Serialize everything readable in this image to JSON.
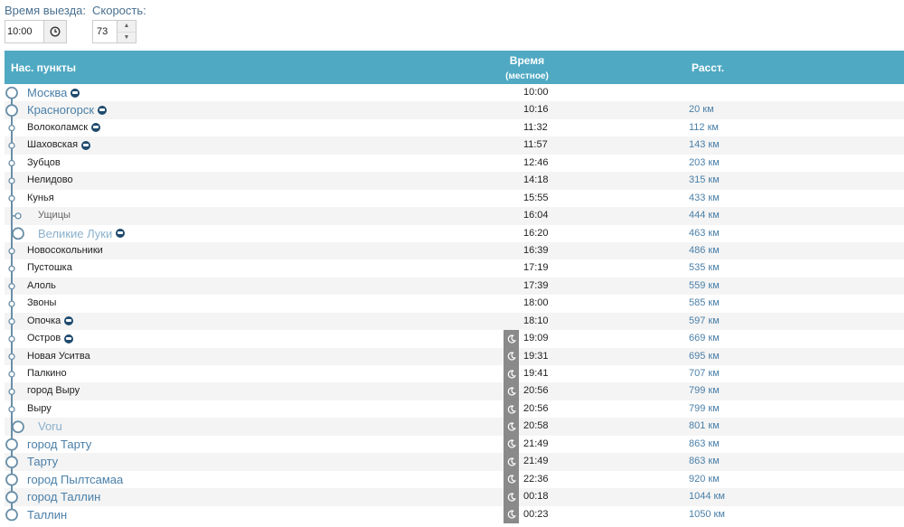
{
  "controls": {
    "departure_label": "Время выезда:",
    "departure_value": "10:00",
    "speed_label": "Скорость:",
    "speed_value": "73"
  },
  "table": {
    "col_name": "Нас. пункты",
    "col_time": "Время",
    "col_time_sub": "(местное)",
    "col_dist": "Расст."
  },
  "rows": [
    {
      "name": "Москва",
      "time": "10:00",
      "dist": "",
      "big": true,
      "bus": true,
      "branch": false,
      "night": false
    },
    {
      "name": "Красногорск",
      "time": "10:16",
      "dist": "20 км",
      "big": true,
      "bus": true,
      "branch": false,
      "night": false
    },
    {
      "name": "Волоколамск",
      "time": "11:32",
      "dist": "112 км",
      "big": false,
      "bus": true,
      "branch": false,
      "night": false
    },
    {
      "name": "Шаховская",
      "time": "11:57",
      "dist": "143 км",
      "big": false,
      "bus": true,
      "branch": false,
      "night": false
    },
    {
      "name": "Зубцов",
      "time": "12:46",
      "dist": "203 км",
      "big": false,
      "bus": false,
      "branch": false,
      "night": false
    },
    {
      "name": "Нелидово",
      "time": "14:18",
      "dist": "315 км",
      "big": false,
      "bus": false,
      "branch": false,
      "night": false
    },
    {
      "name": "Кунья",
      "time": "15:55",
      "dist": "433 км",
      "big": false,
      "bus": false,
      "branch": false,
      "night": false
    },
    {
      "name": "Ущицы",
      "time": "16:04",
      "dist": "444 км",
      "big": false,
      "bus": false,
      "branch": true,
      "night": false
    },
    {
      "name": "Великие Луки",
      "time": "16:20",
      "dist": "463 км",
      "big": true,
      "bus": true,
      "branch": true,
      "night": false
    },
    {
      "name": "Новосокольники",
      "time": "16:39",
      "dist": "486 км",
      "big": false,
      "bus": false,
      "branch": false,
      "night": false
    },
    {
      "name": "Пустошка",
      "time": "17:19",
      "dist": "535 км",
      "big": false,
      "bus": false,
      "branch": false,
      "night": false
    },
    {
      "name": "Алоль",
      "time": "17:39",
      "dist": "559 км",
      "big": false,
      "bus": false,
      "branch": false,
      "night": false
    },
    {
      "name": "Звоны",
      "time": "18:00",
      "dist": "585 км",
      "big": false,
      "bus": false,
      "branch": false,
      "night": false
    },
    {
      "name": "Опочка",
      "time": "18:10",
      "dist": "597 км",
      "big": false,
      "bus": true,
      "branch": false,
      "night": false
    },
    {
      "name": "Остров",
      "time": "19:09",
      "dist": "669 км",
      "big": false,
      "bus": true,
      "branch": false,
      "night": true
    },
    {
      "name": "Новая Уситва",
      "time": "19:31",
      "dist": "695 км",
      "big": false,
      "bus": false,
      "branch": false,
      "night": true
    },
    {
      "name": "Палкино",
      "time": "19:41",
      "dist": "707 км",
      "big": false,
      "bus": false,
      "branch": false,
      "night": true
    },
    {
      "name": "город Выру",
      "time": "20:56",
      "dist": "799 км",
      "big": false,
      "bus": false,
      "branch": false,
      "night": true
    },
    {
      "name": "Выру",
      "time": "20:56",
      "dist": "799 км",
      "big": false,
      "bus": false,
      "branch": false,
      "night": true
    },
    {
      "name": "Voru",
      "time": "20:58",
      "dist": "801 км",
      "big": true,
      "bus": false,
      "branch": true,
      "night": true
    },
    {
      "name": "город Тарту",
      "time": "21:49",
      "dist": "863 км",
      "big": true,
      "bus": false,
      "branch": false,
      "night": true
    },
    {
      "name": "Тарту",
      "time": "21:49",
      "dist": "863 км",
      "big": true,
      "bus": false,
      "branch": false,
      "night": true
    },
    {
      "name": "город Пылтсамаа",
      "time": "22:36",
      "dist": "920 км",
      "big": true,
      "bus": false,
      "branch": false,
      "night": true
    },
    {
      "name": "город Таллин",
      "time": "00:18",
      "dist": "1044 км",
      "big": true,
      "bus": false,
      "branch": false,
      "night": true
    },
    {
      "name": "Таллин",
      "time": "00:23",
      "dist": "1050 км",
      "big": true,
      "bus": false,
      "branch": false,
      "night": true
    }
  ],
  "colors": {
    "header": "#4fa9c3",
    "route": "#6a8fa8",
    "night": "#8a8a8a",
    "link": "#4a7fa8"
  },
  "icons": {
    "clock": "clock-icon",
    "bus": "bus-stop-icon",
    "night": "moon-icon"
  }
}
